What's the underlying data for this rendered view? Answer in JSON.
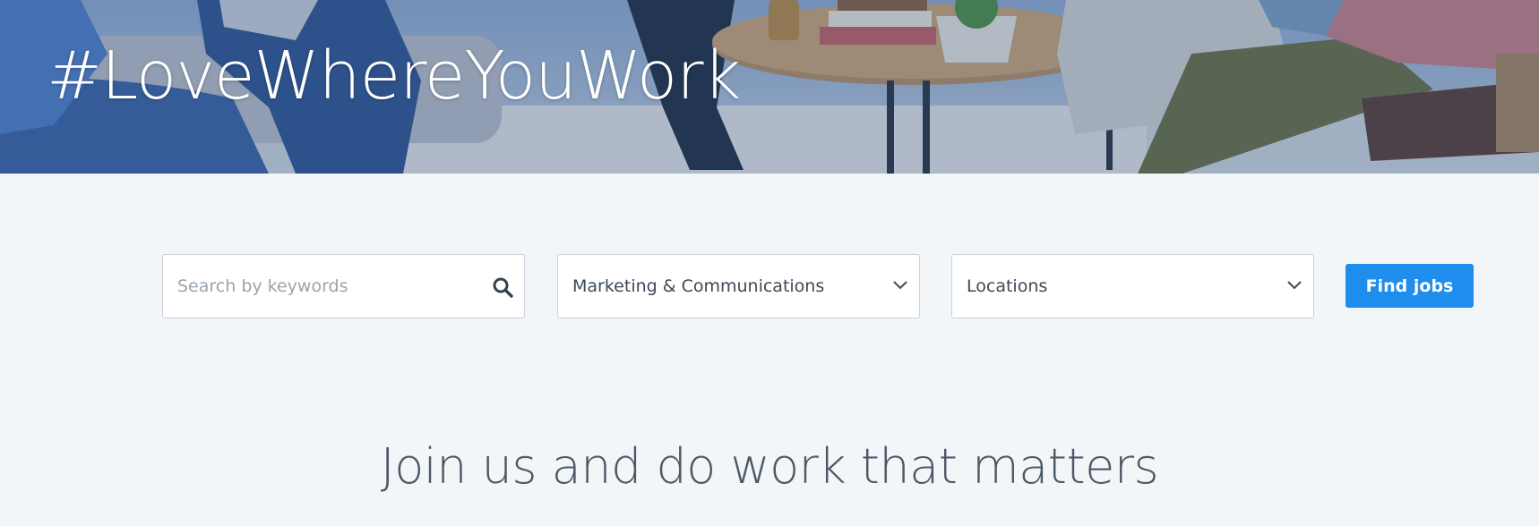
{
  "hero": {
    "title": "#LoveWhereYouWork",
    "image_alt": "office-lounge-photo"
  },
  "search": {
    "keyword_placeholder": "Search by keywords",
    "keyword_value": "",
    "category_selected": "Marketing & Communications",
    "location_selected": "Locations",
    "submit_label": "Find jobs",
    "icons": {
      "search": "search-icon",
      "dropdown": "chevron-down-icon"
    }
  },
  "tagline": "Join us and do work that matters",
  "colors": {
    "accent": "#1f8ded",
    "page_background": "#f3f6f9",
    "heading_text": "#4b5866",
    "hero_overlay": "#2a5696"
  }
}
